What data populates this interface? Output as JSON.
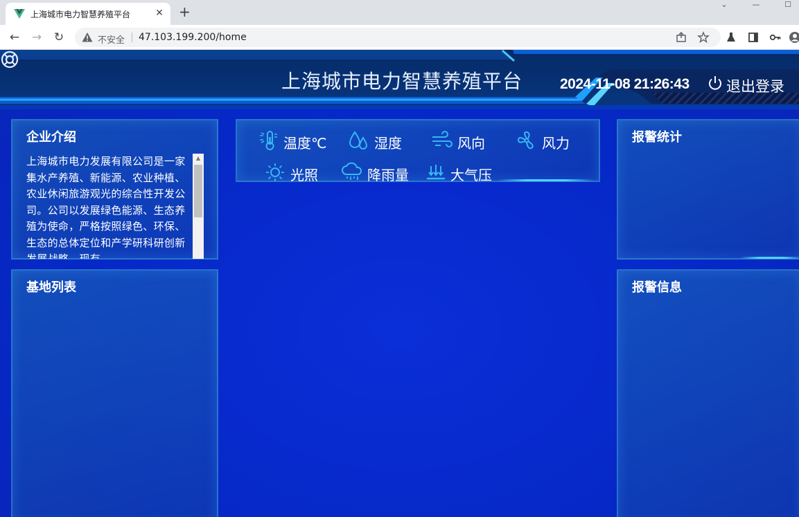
{
  "browser": {
    "tab_title": "上海城市电力智慧养殖平台",
    "tab_close": "✕",
    "new_tab": "+",
    "security_label": "不安全",
    "url": "47.103.199.200/home",
    "back_glyph": "←",
    "forward_glyph": "→",
    "reload_glyph": "↻",
    "minimize_glyph": "—",
    "maximize_glyph": "☐",
    "dropdown_glyph": "⌄"
  },
  "header": {
    "title": "上海城市电力智慧养殖平台",
    "datetime": "2024-11-08 21:26:43",
    "logout_label": "退出登录"
  },
  "panels": {
    "intro": {
      "title": "企业介绍",
      "text": "上海城市电力发展有限公司是一家集水产养殖、新能源、农业种植、农业休闲旅游观光的综合性开发公司。公司以发展绿色能源、生态养殖为使命，严格按照绿色、环保、生态的总体定位和产学研科研创新发展战略，现有"
    },
    "bases": {
      "title": "基地列表"
    },
    "alarm_stats": {
      "title": "报警统计"
    },
    "alarm_info": {
      "title": "报警信息"
    }
  },
  "weather": {
    "items": [
      {
        "label": "温度℃",
        "icon": "thermometer-icon"
      },
      {
        "label": "湿度",
        "icon": "droplets-icon"
      },
      {
        "label": "风向",
        "icon": "wind-icon"
      },
      {
        "label": "风力",
        "icon": "fan-icon"
      },
      {
        "label": "光照",
        "icon": "sun-icon"
      },
      {
        "label": "降雨量",
        "icon": "rain-cloud-icon"
      },
      {
        "label": "大气压",
        "icon": "pressure-icon"
      }
    ]
  },
  "colors": {
    "background": "#0628c6",
    "accent_cyan": "#4fd3ff",
    "icon_cyan": "#37b7f2",
    "panel_border": "#3ca0dc"
  }
}
